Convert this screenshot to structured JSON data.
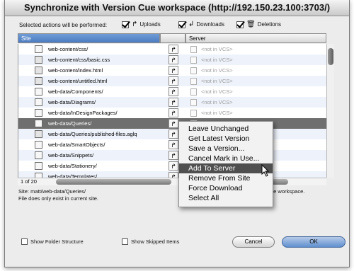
{
  "window": {
    "title": "Synchronize with Version Cue workspace (http://192.150.23.100:3703/)"
  },
  "actions": {
    "label": "Selected actions will be performed:",
    "uploads": "Uploads",
    "downloads": "Downloads",
    "deletions": "Deletions"
  },
  "columns": {
    "site": "Site",
    "server": "Server"
  },
  "rows": [
    {
      "name": "web-content/css/",
      "server": "<not in VCS>"
    },
    {
      "name": "web-content/css/basic.css",
      "server": "<not in VCS>"
    },
    {
      "name": "web-content/index.html",
      "server": "<not in VCS>"
    },
    {
      "name": "web-content/untitled.html",
      "server": "<not in VCS>"
    },
    {
      "name": "web-data/Components/",
      "server": "<not in VCS>"
    },
    {
      "name": "web-data/Diagrams/",
      "server": "<not in VCS>"
    },
    {
      "name": "web-data/InDesignPackages/",
      "server": "<not in VCS>"
    },
    {
      "name": "web-data/Queries/",
      "server": ""
    },
    {
      "name": "web-data/Queries/published-files.aglq",
      "server": ""
    },
    {
      "name": "web-data/SmartObjects/",
      "server": ""
    },
    {
      "name": "web-data/Snippets/",
      "server": ""
    },
    {
      "name": "web-data/Stationery/",
      "server": ""
    },
    {
      "name": "web-data/Templates/",
      "server": ""
    }
  ],
  "count": "1 of 20",
  "info": {
    "line1": "Site: matt/web-data/Queries/",
    "line2": "File does only exist in current site.",
    "right": "ue workspace."
  },
  "context_menu": [
    "Leave Unchanged",
    "Get Latest Version",
    "Save a Version...",
    "Cancel Mark in Use...",
    "Add To Server",
    "Remove From Site",
    "Force Download",
    "Select All"
  ],
  "options": {
    "show_folder_structure": "Show Folder Structure",
    "show_skipped_items": "Show Skipped Items"
  },
  "buttons": {
    "cancel": "Cancel",
    "ok": "OK"
  }
}
